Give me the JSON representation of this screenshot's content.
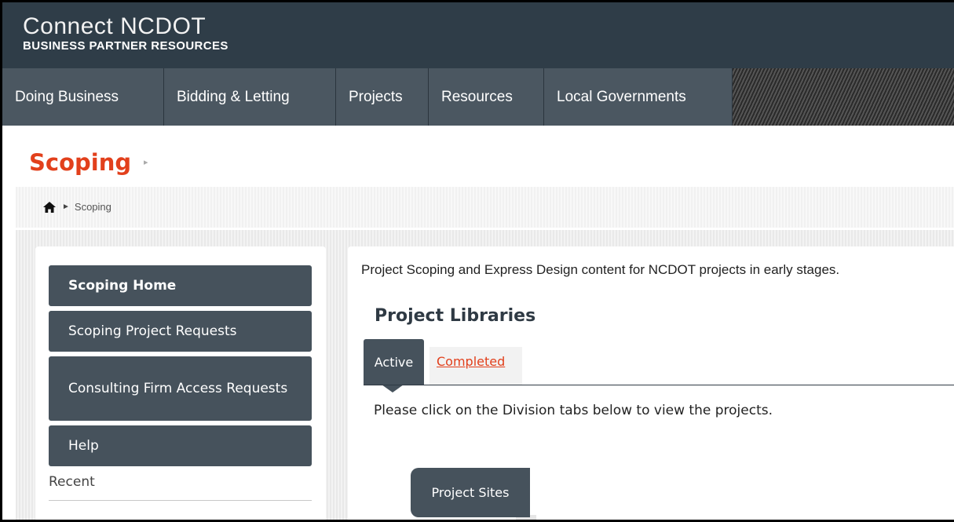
{
  "header": {
    "logo_title": "Connect NCDOT",
    "logo_subtitle": "BUSINESS PARTNER RESOURCES"
  },
  "nav": {
    "items": [
      {
        "label": "Doing Business"
      },
      {
        "label": "Bidding & Letting"
      },
      {
        "label": "Projects"
      },
      {
        "label": "Resources"
      },
      {
        "label": "Local Governments"
      }
    ]
  },
  "page": {
    "title": "Scoping",
    "title_arrow": "▸"
  },
  "breadcrumb": {
    "separator": "►",
    "current": "Scoping",
    "home_icon": "home-icon"
  },
  "sidebar": {
    "items": [
      {
        "label": "Scoping Home"
      },
      {
        "label": "Scoping Project Requests"
      },
      {
        "label": "Consulting Firm Access Requests"
      },
      {
        "label": "Help"
      }
    ],
    "recent_label": "Recent"
  },
  "main": {
    "intro": "Project Scoping and Express Design content for NCDOT projects in early stages.",
    "libraries_heading": "Project Libraries",
    "tabs": [
      {
        "label": "Active"
      },
      {
        "label": "Completed"
      }
    ],
    "note": "Please click on the Division tabs below to view the projects.",
    "project_sites_label": "Project Sites"
  },
  "colors": {
    "header_bg": "#2f3d48",
    "nav_bg": "#46525c",
    "accent": "#e2401c"
  }
}
